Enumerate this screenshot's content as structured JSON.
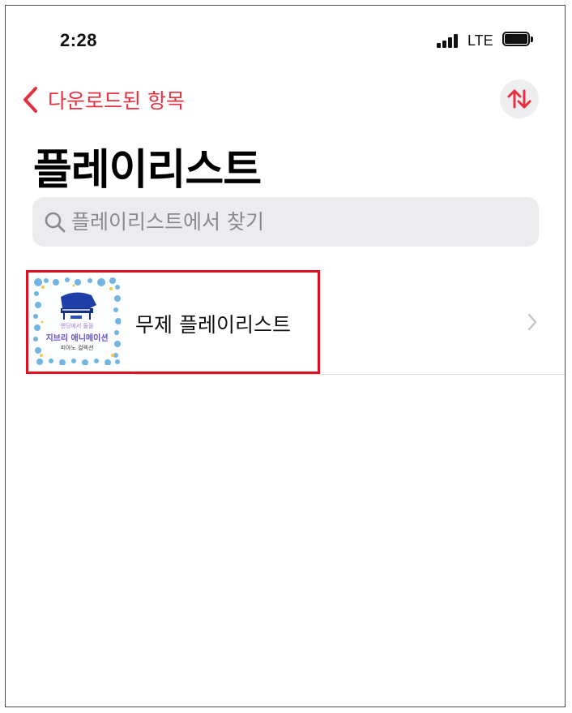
{
  "status_bar": {
    "time": "2:28",
    "network": "LTE"
  },
  "nav": {
    "back_label": "다운로드된 항목",
    "accent_color": "#e53040",
    "sort_icon": "sort-arrows-icon"
  },
  "page": {
    "title": "플레이리스트"
  },
  "search": {
    "placeholder": "플레이리스트에서 찾기",
    "value": ""
  },
  "playlists": [
    {
      "title": "무제 플레이리스트",
      "artwork": {
        "line1": "엔딩에서 들을",
        "line2": "지브리 애니메이션",
        "line3": "피아노 컬렉션"
      },
      "highlighted": true
    }
  ]
}
